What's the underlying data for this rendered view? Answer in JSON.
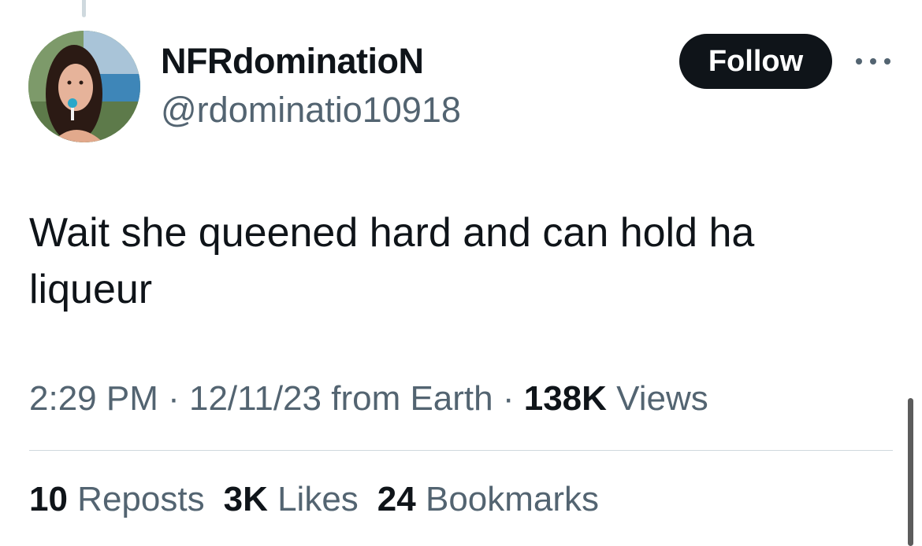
{
  "user": {
    "display_name": "NFRdominatioN",
    "handle": "@rdominatio10918",
    "avatar_icon": "profile-photo"
  },
  "actions": {
    "follow_label": "Follow",
    "more_icon": "more-horizontal-icon"
  },
  "tweet": {
    "text": "Wait she queened hard and can hold ha liqueur"
  },
  "meta": {
    "time": "2:29 PM",
    "sep1": " · ",
    "date": "12/11/23",
    "source": " from Earth",
    "sep2": " · ",
    "views_count": "138K",
    "views_label": " Views"
  },
  "stats": {
    "reposts_count": "10",
    "reposts_label": " Reposts",
    "likes_count": "3K",
    "likes_label": " Likes",
    "bookmarks_count": "24",
    "bookmarks_label": " Bookmarks"
  },
  "colors": {
    "text_primary": "#0f1419",
    "text_secondary": "#536471",
    "divider": "#cfd9de",
    "follow_bg": "#0f1419"
  }
}
